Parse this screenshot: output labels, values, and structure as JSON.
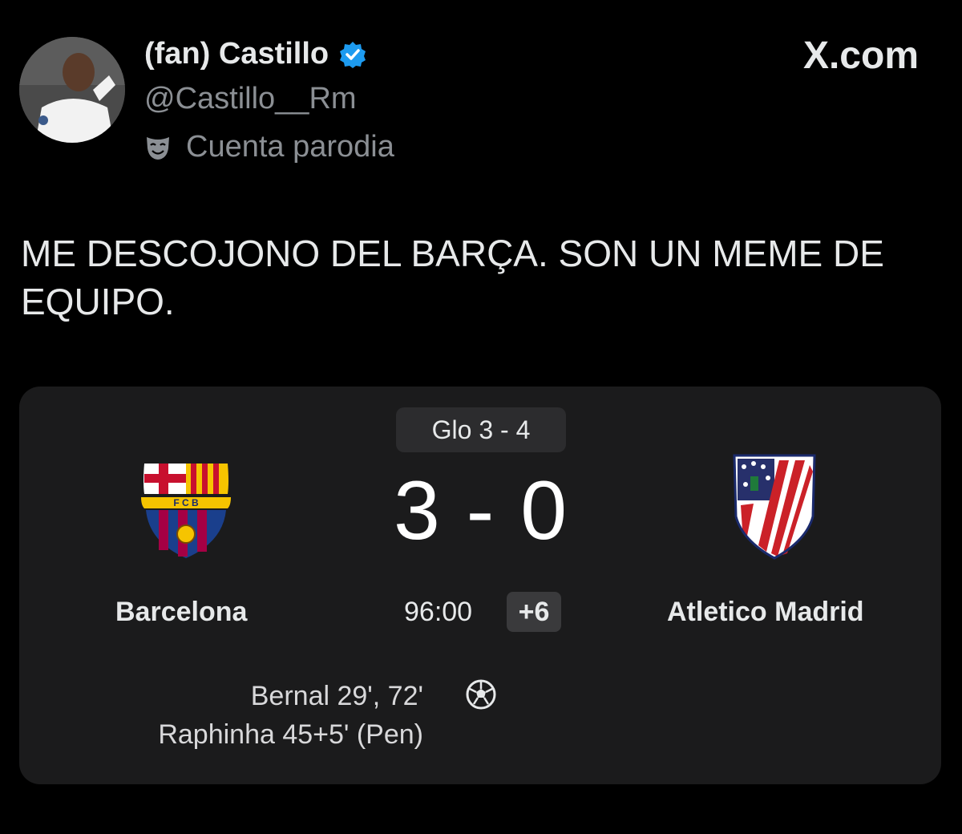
{
  "author": {
    "name": "(fan) Castillo",
    "handle": "@Castillo__Rm",
    "parody_label": "Cuenta parodia"
  },
  "brand": "X.com",
  "tweet": {
    "text": "ME DESCOJONO DEL BARÇA. SON UN MEME DE EQUIPO."
  },
  "match": {
    "aggregate": "Glo 3 - 4",
    "score": "3 - 0",
    "home_team": "Barcelona",
    "away_team": "Atletico Madrid",
    "clock": "96:00",
    "added_time": "+6",
    "scorers": [
      "Bernal 29', 72'",
      "Raphinha 45+5' (Pen)"
    ],
    "home_crest_text": "FCB"
  },
  "colors": {
    "background": "#000000",
    "card": "#1b1b1c",
    "verified": "#1d9bf0",
    "muted_text": "#8b8f94"
  }
}
